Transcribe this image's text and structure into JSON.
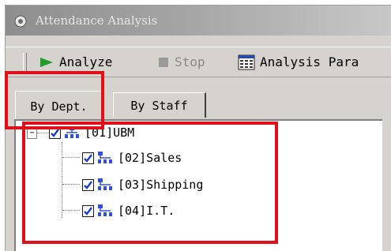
{
  "window": {
    "title": "Attendance Analysis",
    "title_icon": "app-gear-icon"
  },
  "toolbar": {
    "analyze_label": "Analyze",
    "stop_label": "Stop",
    "params_label": "Analysis Para"
  },
  "tabs": [
    {
      "label": "By Dept.",
      "active": true
    },
    {
      "label": "By Staff",
      "active": false
    }
  ],
  "tree": {
    "root": {
      "label": "[01]UBM",
      "checked": true,
      "expanded": true,
      "expander": "−"
    },
    "children": [
      {
        "label": "[02]Sales",
        "checked": true
      },
      {
        "label": "[03]Shipping",
        "checked": true
      },
      {
        "label": "[04]I.T.",
        "checked": true
      }
    ]
  },
  "colors": {
    "highlight": "#e0101a",
    "check": "#1a3fcf",
    "org_icon": "#3050d8",
    "analyze_icon": "#1f9e2c"
  }
}
